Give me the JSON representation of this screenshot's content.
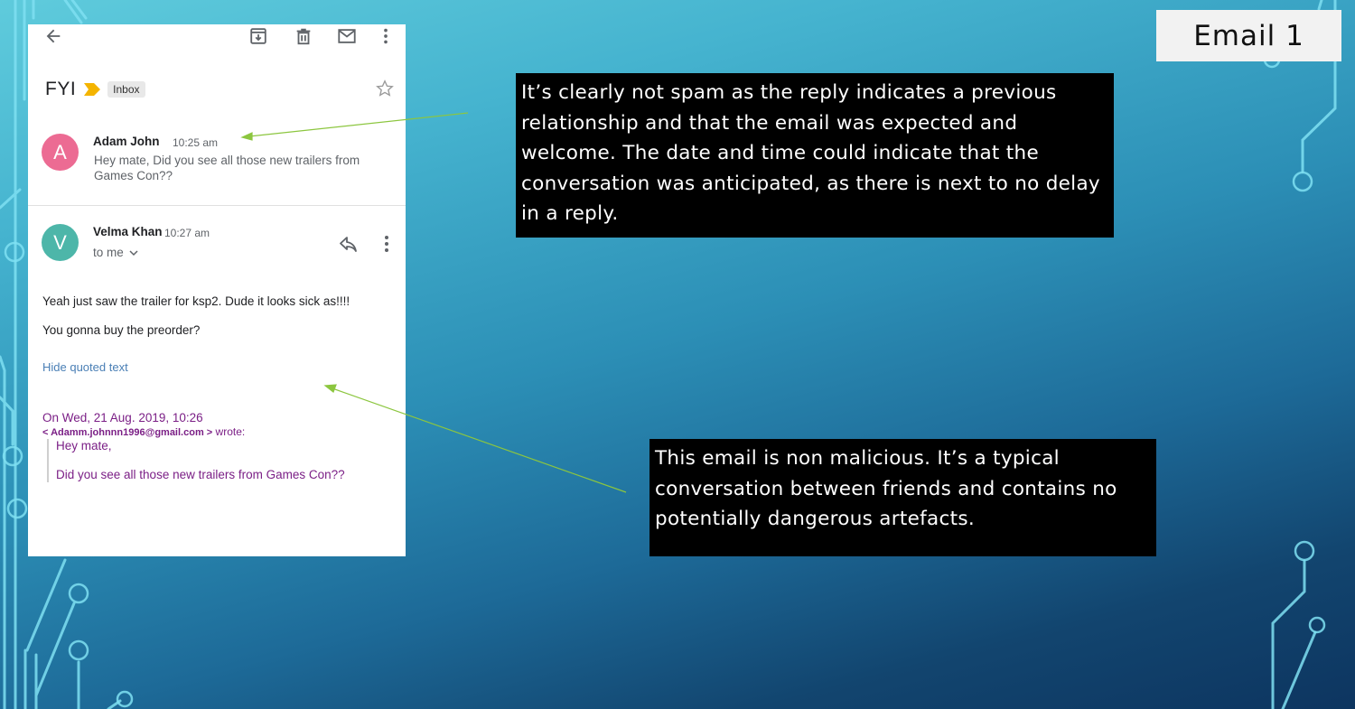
{
  "slide": {
    "title": "Email 1"
  },
  "email": {
    "toolbar": {
      "icons": [
        "back-arrow-icon",
        "archive-icon",
        "delete-icon",
        "mark-unread-icon",
        "more-vert-icon"
      ]
    },
    "subject": "FYI",
    "label": "Inbox",
    "colors": {
      "avatar_a": "#ec6b93",
      "avatar_v": "#4db6a9",
      "importance": "#f4b400",
      "quote_text": "#7b1f86",
      "link": "#4a7fb5"
    },
    "messages": [
      {
        "avatar_letter": "A",
        "sender": "Adam John",
        "time": "10:25 am",
        "snippet": "Hey mate, Did you see all those new trailers from Games Con??"
      },
      {
        "avatar_letter": "V",
        "sender": "Velma Khan",
        "time": "10:27 am",
        "recipient": "to me",
        "body": [
          "Yeah just saw the trailer for ksp2. Dude it looks sick as!!!!",
          "You gonna buy the preorder?"
        ],
        "hide_quoted_label": "Hide quoted text",
        "quote": {
          "date_line": "On Wed, 21 Aug. 2019, 10:26",
          "from_email": "< Adamm.johnnn1996@gmail.com >",
          "wrote": "wrote:",
          "lines": [
            "Hey mate,",
            "Did you see all those new trailers from Games Con??"
          ]
        }
      }
    ]
  },
  "callouts": [
    {
      "text": "It’s clearly not spam as the reply indicates a previous relationship and that the email was expected and welcome. The date and time could indicate that the conversation was anticipated, as there is next to no delay in a reply."
    },
    {
      "text": "This email is non malicious. It’s a typical conversation between friends and contains no potentially dangerous artefacts."
    }
  ],
  "arrow_color": "#8cc63f"
}
